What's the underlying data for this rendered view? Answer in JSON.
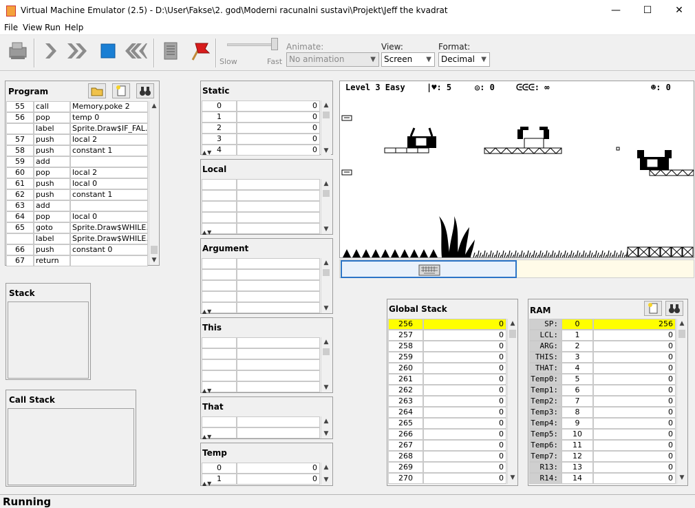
{
  "window": {
    "title": "Virtual Machine Emulator (2.5) - D:\\User\\Fakse\\2. god\\Moderni racunalni sustavi\\Projekt\\Jeff the kvadrat",
    "minimize": "—",
    "maximize": "☐",
    "close": "✕"
  },
  "menu": [
    "File",
    "View",
    "Run",
    "Help"
  ],
  "toolbar": {
    "speed_slow": "Slow",
    "speed_fast": "Fast",
    "animate_label": "Animate:",
    "animate_value": "No animation",
    "view_label": "View:",
    "view_value": "Screen",
    "format_label": "Format:",
    "format_value": "Decimal"
  },
  "program": {
    "title": "Program",
    "rows": [
      {
        "line": "55",
        "cmd": "call",
        "arg": "Memory.poke 2"
      },
      {
        "line": "56",
        "cmd": "pop",
        "arg": "temp 0"
      },
      {
        "line": "",
        "cmd": "label",
        "arg": "Sprite.Draw$IF_FAL..."
      },
      {
        "line": "57",
        "cmd": "push",
        "arg": "local 2"
      },
      {
        "line": "58",
        "cmd": "push",
        "arg": "constant 1"
      },
      {
        "line": "59",
        "cmd": "add",
        "arg": ""
      },
      {
        "line": "60",
        "cmd": "pop",
        "arg": "local 2"
      },
      {
        "line": "61",
        "cmd": "push",
        "arg": "local 0"
      },
      {
        "line": "62",
        "cmd": "push",
        "arg": "constant 1"
      },
      {
        "line": "63",
        "cmd": "add",
        "arg": ""
      },
      {
        "line": "64",
        "cmd": "pop",
        "arg": "local 0"
      },
      {
        "line": "65",
        "cmd": "goto",
        "arg": "Sprite.Draw$WHILE..."
      },
      {
        "line": "",
        "cmd": "label",
        "arg": "Sprite.Draw$WHILE..."
      },
      {
        "line": "66",
        "cmd": "push",
        "arg": "constant 0"
      },
      {
        "line": "67",
        "cmd": "return",
        "arg": ""
      }
    ]
  },
  "stack": {
    "title": "Stack"
  },
  "call_stack": {
    "title": "Call Stack"
  },
  "static": {
    "title": "Static",
    "rows": [
      {
        "idx": "0",
        "val": "0"
      },
      {
        "idx": "1",
        "val": "0"
      },
      {
        "idx": "2",
        "val": "0"
      },
      {
        "idx": "3",
        "val": "0"
      },
      {
        "idx": "4",
        "val": "0"
      }
    ]
  },
  "local": {
    "title": "Local"
  },
  "argument": {
    "title": "Argument"
  },
  "this": {
    "title": "This"
  },
  "that": {
    "title": "That"
  },
  "temp": {
    "title": "Temp",
    "rows": [
      {
        "idx": "0",
        "val": "0"
      },
      {
        "idx": "1",
        "val": "0"
      }
    ]
  },
  "screen_hud": {
    "level": "Level 3 Easy",
    "lives": "|♥: 5",
    "coins": "◎: 0",
    "ammo": "ᕮᕮᕮ: ∞",
    "kills": "☻: 0"
  },
  "global_stack": {
    "title": "Global Stack",
    "rows": [
      {
        "addr": "256",
        "val": "0"
      },
      {
        "addr": "257",
        "val": "0"
      },
      {
        "addr": "258",
        "val": "0"
      },
      {
        "addr": "259",
        "val": "0"
      },
      {
        "addr": "260",
        "val": "0"
      },
      {
        "addr": "261",
        "val": "0"
      },
      {
        "addr": "262",
        "val": "0"
      },
      {
        "addr": "263",
        "val": "0"
      },
      {
        "addr": "264",
        "val": "0"
      },
      {
        "addr": "265",
        "val": "0"
      },
      {
        "addr": "266",
        "val": "0"
      },
      {
        "addr": "267",
        "val": "0"
      },
      {
        "addr": "268",
        "val": "0"
      },
      {
        "addr": "269",
        "val": "0"
      },
      {
        "addr": "270",
        "val": "0"
      }
    ]
  },
  "ram": {
    "title": "RAM",
    "rows": [
      {
        "name": "SP:",
        "addr": "0",
        "val": "256"
      },
      {
        "name": "LCL:",
        "addr": "1",
        "val": "0"
      },
      {
        "name": "ARG:",
        "addr": "2",
        "val": "0"
      },
      {
        "name": "THIS:",
        "addr": "3",
        "val": "0"
      },
      {
        "name": "THAT:",
        "addr": "4",
        "val": "0"
      },
      {
        "name": "Temp0:",
        "addr": "5",
        "val": "0"
      },
      {
        "name": "Temp1:",
        "addr": "6",
        "val": "0"
      },
      {
        "name": "Temp2:",
        "addr": "7",
        "val": "0"
      },
      {
        "name": "Temp3:",
        "addr": "8",
        "val": "0"
      },
      {
        "name": "Temp4:",
        "addr": "9",
        "val": "0"
      },
      {
        "name": "Temp5:",
        "addr": "10",
        "val": "0"
      },
      {
        "name": "Temp6:",
        "addr": "11",
        "val": "0"
      },
      {
        "name": "Temp7:",
        "addr": "12",
        "val": "0"
      },
      {
        "name": "R13:",
        "addr": "13",
        "val": "0"
      },
      {
        "name": "R14:",
        "addr": "14",
        "val": "0"
      }
    ]
  },
  "status": "Running",
  "colors": {
    "highlight": "#ffff00",
    "stop_blue": "#1a7fd4",
    "flag_red": "#d81c1c"
  }
}
